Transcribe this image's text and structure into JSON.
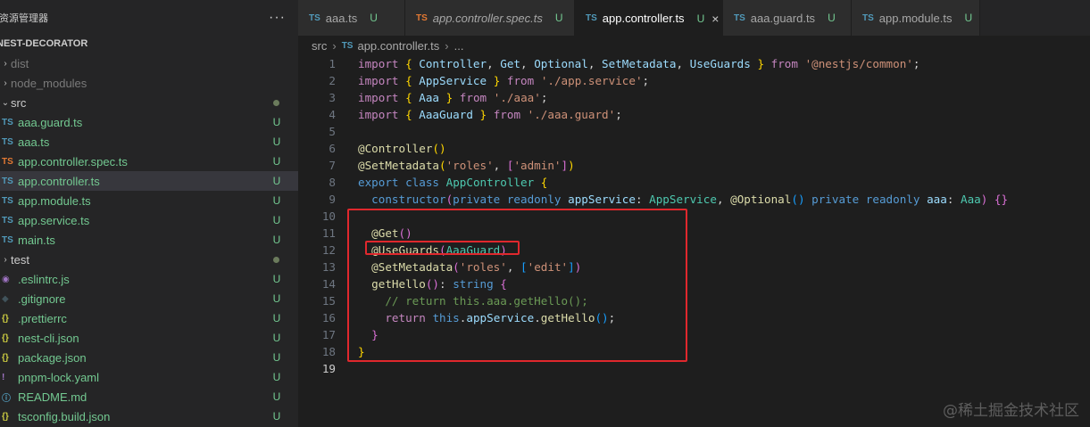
{
  "explorer": {
    "title": "资源管理器",
    "more": "···",
    "section": "NEST-DECORATOR",
    "items": [
      {
        "name": "dist",
        "type": "folder",
        "chev": ">",
        "icon": "",
        "status": "",
        "dim": true
      },
      {
        "name": "node_modules",
        "type": "folder",
        "chev": ">",
        "icon": "",
        "status": "",
        "dim": true
      },
      {
        "name": "src",
        "type": "folder",
        "chev": "v",
        "icon": "",
        "status": "dot",
        "dim": false
      },
      {
        "name": "aaa.guard.ts",
        "type": "file",
        "icon": "TS",
        "iconClass": "ts-icon",
        "status": "U"
      },
      {
        "name": "aaa.ts",
        "type": "file",
        "icon": "TS",
        "iconClass": "ts-icon",
        "status": "U"
      },
      {
        "name": "app.controller.spec.ts",
        "type": "file",
        "icon": "TS",
        "iconClass": "ts-icon-orange",
        "status": "U"
      },
      {
        "name": "app.controller.ts",
        "type": "file",
        "icon": "TS",
        "iconClass": "ts-icon",
        "status": "U",
        "selected": true
      },
      {
        "name": "app.module.ts",
        "type": "file",
        "icon": "TS",
        "iconClass": "ts-icon",
        "status": "U"
      },
      {
        "name": "app.service.ts",
        "type": "file",
        "icon": "TS",
        "iconClass": "ts-icon",
        "status": "U"
      },
      {
        "name": "main.ts",
        "type": "file",
        "icon": "TS",
        "iconClass": "ts-icon",
        "status": "U"
      },
      {
        "name": "test",
        "type": "folder",
        "chev": ">",
        "icon": "",
        "status": "dot",
        "dim": false
      },
      {
        "name": ".eslintrc.js",
        "type": "file",
        "icon": "◉",
        "iconClass": "eslint-icon",
        "status": "U"
      },
      {
        "name": ".gitignore",
        "type": "file",
        "icon": "◆",
        "iconClass": "git-icon",
        "status": "U"
      },
      {
        "name": ".prettierrc",
        "type": "file",
        "icon": "{}",
        "iconClass": "json-icon",
        "status": "U"
      },
      {
        "name": "nest-cli.json",
        "type": "file",
        "icon": "{}",
        "iconClass": "json-icon",
        "status": "U"
      },
      {
        "name": "package.json",
        "type": "file",
        "icon": "{}",
        "iconClass": "json-icon",
        "status": "U"
      },
      {
        "name": "pnpm-lock.yaml",
        "type": "file",
        "icon": "!",
        "iconClass": "yaml-icon",
        "status": "U"
      },
      {
        "name": "README.md",
        "type": "file",
        "icon": "ⓘ",
        "iconClass": "info-icon",
        "status": "U"
      },
      {
        "name": "tsconfig.build.json",
        "type": "file",
        "icon": "{}",
        "iconClass": "json-icon",
        "status": "U"
      }
    ]
  },
  "tabs": [
    {
      "label": "aaa.ts",
      "status": "U",
      "icon": "TS",
      "orange": false,
      "italic": false,
      "active": false
    },
    {
      "label": "app.controller.spec.ts",
      "status": "U",
      "icon": "TS",
      "orange": true,
      "italic": true,
      "active": false
    },
    {
      "label": "app.controller.ts",
      "status": "U",
      "icon": "TS",
      "orange": false,
      "italic": false,
      "active": true,
      "close": "×"
    },
    {
      "label": "aaa.guard.ts",
      "status": "U",
      "icon": "TS",
      "orange": false,
      "italic": false,
      "active": false
    },
    {
      "label": "app.module.ts",
      "status": "U",
      "icon": "TS",
      "orange": false,
      "italic": false,
      "active": false
    }
  ],
  "breadcrumb": {
    "folder": "src",
    "icon": "TS",
    "file": "app.controller.ts",
    "rest": "..."
  },
  "editor": {
    "active_line": 19,
    "lines": [
      [
        [
          "kw",
          "import"
        ],
        [
          "punc",
          " "
        ],
        [
          "brace1",
          "{"
        ],
        [
          "var",
          " Controller"
        ],
        [
          "punc",
          ", "
        ],
        [
          "var",
          "Get"
        ],
        [
          "punc",
          ", "
        ],
        [
          "var",
          "Optional"
        ],
        [
          "punc",
          ", "
        ],
        [
          "var",
          "SetMetadata"
        ],
        [
          "punc",
          ", "
        ],
        [
          "var",
          "UseGuards "
        ],
        [
          "brace1",
          "}"
        ],
        [
          "punc",
          " "
        ],
        [
          "kw",
          "from"
        ],
        [
          "punc",
          " "
        ],
        [
          "str",
          "'@nestjs/common'"
        ],
        [
          "punc",
          ";"
        ]
      ],
      [
        [
          "kw",
          "import"
        ],
        [
          "punc",
          " "
        ],
        [
          "brace1",
          "{"
        ],
        [
          "var",
          " AppService "
        ],
        [
          "brace1",
          "}"
        ],
        [
          "punc",
          " "
        ],
        [
          "kw",
          "from"
        ],
        [
          "punc",
          " "
        ],
        [
          "str",
          "'./app.service'"
        ],
        [
          "punc",
          ";"
        ]
      ],
      [
        [
          "kw",
          "import"
        ],
        [
          "punc",
          " "
        ],
        [
          "brace1",
          "{"
        ],
        [
          "var",
          " Aaa "
        ],
        [
          "brace1",
          "}"
        ],
        [
          "punc",
          " "
        ],
        [
          "kw",
          "from"
        ],
        [
          "punc",
          " "
        ],
        [
          "str",
          "'./aaa'"
        ],
        [
          "punc",
          ";"
        ]
      ],
      [
        [
          "kw",
          "import"
        ],
        [
          "punc",
          " "
        ],
        [
          "brace1",
          "{"
        ],
        [
          "var",
          " AaaGuard "
        ],
        [
          "brace1",
          "}"
        ],
        [
          "punc",
          " "
        ],
        [
          "kw",
          "from"
        ],
        [
          "punc",
          " "
        ],
        [
          "str",
          "'./aaa.guard'"
        ],
        [
          "punc",
          ";"
        ]
      ],
      [],
      [
        [
          "dec",
          "@Controller"
        ],
        [
          "brace1",
          "()"
        ]
      ],
      [
        [
          "dec",
          "@SetMetadata"
        ],
        [
          "brace1",
          "("
        ],
        [
          "str",
          "'roles'"
        ],
        [
          "punc",
          ", "
        ],
        [
          "brace2",
          "["
        ],
        [
          "str",
          "'admin'"
        ],
        [
          "brace2",
          "]"
        ],
        [
          "brace1",
          ")"
        ]
      ],
      [
        [
          "kw2",
          "export"
        ],
        [
          "punc",
          " "
        ],
        [
          "kw2",
          "class"
        ],
        [
          "punc",
          " "
        ],
        [
          "cls",
          "AppController"
        ],
        [
          "punc",
          " "
        ],
        [
          "brace1",
          "{"
        ]
      ],
      [
        [
          "punc",
          "  "
        ],
        [
          "kw2",
          "constructor"
        ],
        [
          "brace2",
          "("
        ],
        [
          "kw2",
          "private"
        ],
        [
          "punc",
          " "
        ],
        [
          "kw2",
          "readonly"
        ],
        [
          "punc",
          " "
        ],
        [
          "var",
          "appService"
        ],
        [
          "punc",
          ": "
        ],
        [
          "cls",
          "AppService"
        ],
        [
          "punc",
          ", "
        ],
        [
          "dec",
          "@Optional"
        ],
        [
          "brace3",
          "()"
        ],
        [
          "punc",
          " "
        ],
        [
          "kw2",
          "private"
        ],
        [
          "punc",
          " "
        ],
        [
          "kw2",
          "readonly"
        ],
        [
          "punc",
          " "
        ],
        [
          "var",
          "aaa"
        ],
        [
          "punc",
          ": "
        ],
        [
          "cls",
          "Aaa"
        ],
        [
          "brace2",
          ")"
        ],
        [
          "punc",
          " "
        ],
        [
          "brace2",
          "{}"
        ]
      ],
      [],
      [
        [
          "punc",
          "  "
        ],
        [
          "dec",
          "@Get"
        ],
        [
          "brace2",
          "()"
        ]
      ],
      [
        [
          "punc",
          "  "
        ],
        [
          "dec",
          "@UseGuards"
        ],
        [
          "brace2",
          "("
        ],
        [
          "cls",
          "AaaGuard"
        ],
        [
          "brace2",
          ")"
        ]
      ],
      [
        [
          "punc",
          "  "
        ],
        [
          "dec",
          "@SetMetadata"
        ],
        [
          "brace2",
          "("
        ],
        [
          "str",
          "'roles'"
        ],
        [
          "punc",
          ", "
        ],
        [
          "brace3",
          "["
        ],
        [
          "str",
          "'edit'"
        ],
        [
          "brace3",
          "]"
        ],
        [
          "brace2",
          ")"
        ]
      ],
      [
        [
          "punc",
          "  "
        ],
        [
          "fn",
          "getHello"
        ],
        [
          "brace2",
          "()"
        ],
        [
          "punc",
          ": "
        ],
        [
          "kw2",
          "string"
        ],
        [
          "punc",
          " "
        ],
        [
          "brace2",
          "{"
        ]
      ],
      [
        [
          "punc",
          "    "
        ],
        [
          "cmt",
          "// return this.aaa.getHello();"
        ]
      ],
      [
        [
          "punc",
          "    "
        ],
        [
          "kw",
          "return"
        ],
        [
          "punc",
          " "
        ],
        [
          "kw2",
          "this"
        ],
        [
          "punc",
          "."
        ],
        [
          "var",
          "appService"
        ],
        [
          "punc",
          "."
        ],
        [
          "fn",
          "getHello"
        ],
        [
          "brace3",
          "()"
        ],
        [
          "punc",
          ";"
        ]
      ],
      [
        [
          "punc",
          "  "
        ],
        [
          "brace2",
          "}"
        ]
      ],
      [
        [
          "brace1",
          "}"
        ]
      ],
      []
    ]
  },
  "watermark": "@稀土掘金技术社区"
}
